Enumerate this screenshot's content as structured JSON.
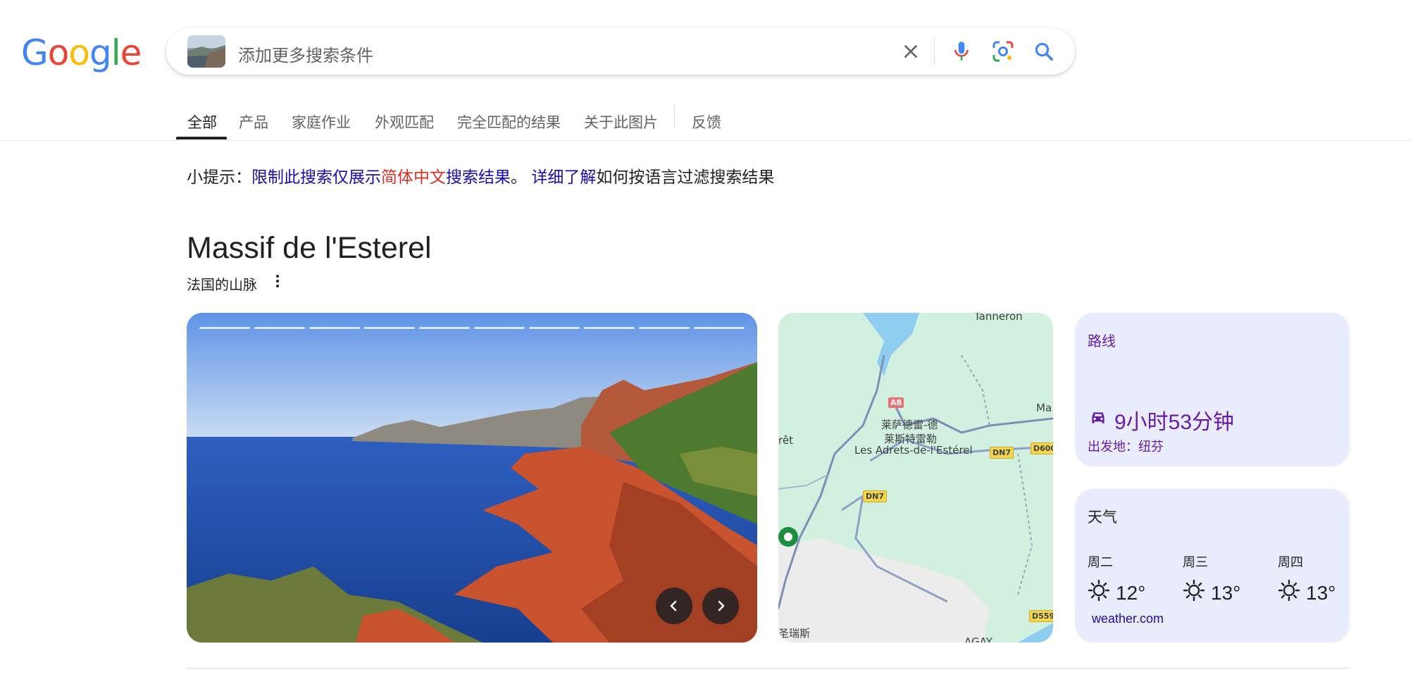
{
  "logo": {
    "letters": [
      "G",
      "o",
      "o",
      "g",
      "l",
      "e"
    ],
    "colors": [
      "#4285f4",
      "#ea4335",
      "#fbbc05",
      "#4285f4",
      "#34a853",
      "#ea4335"
    ]
  },
  "search": {
    "query_placeholder": "添加更多搜索条件",
    "icons": [
      "image-thumbnail",
      "close-icon",
      "mic-icon",
      "lens-icon",
      "search-icon"
    ]
  },
  "tabs": [
    {
      "label": "全部",
      "active": true
    },
    {
      "label": "产品"
    },
    {
      "label": "家庭作业"
    },
    {
      "label": "外观匹配"
    },
    {
      "label": "完全匹配的结果"
    },
    {
      "label": "关于此图片"
    },
    {
      "label": "反馈"
    }
  ],
  "tip": {
    "prefix": "小提示：",
    "link1_a": "限制此搜索仅展示",
    "link1_lang": "简体中文",
    "link1_b": "搜索结果",
    "sep": "。",
    "link2": "详细了解",
    "suffix": "如何按语言过滤搜索结果"
  },
  "entity": {
    "title": "Massif de l'Esterel",
    "subtitle": "法国的山脉"
  },
  "carousel": {
    "segments": 10,
    "icons": [
      "chevron-left-icon",
      "chevron-right-icon"
    ]
  },
  "map": {
    "labels": {
      "tanneron": "Tanneron",
      "place_zh1": "莱萨德雷-德",
      "place_zh2": "莱斯特雷勒",
      "place_fr": "Les Adrets-de-l'Estérel",
      "ma": "Ma",
      "ret": "rêt",
      "bottom_zh": "圣瑞斯",
      "bottom_fr": "AGAY"
    },
    "roads": {
      "a8": "A8",
      "dn7a": "DN7",
      "dn7b": "DN7",
      "d600": "D600",
      "d559": "D559"
    }
  },
  "route": {
    "title": "路线",
    "duration": "9小时53分钟",
    "origin": "出发地：纽芬"
  },
  "weather": {
    "title": "天气",
    "days": [
      {
        "name": "周二",
        "temp": "12°"
      },
      {
        "name": "周三",
        "temp": "13°"
      },
      {
        "name": "周四",
        "temp": "13°"
      }
    ],
    "source": "weather.com"
  }
}
